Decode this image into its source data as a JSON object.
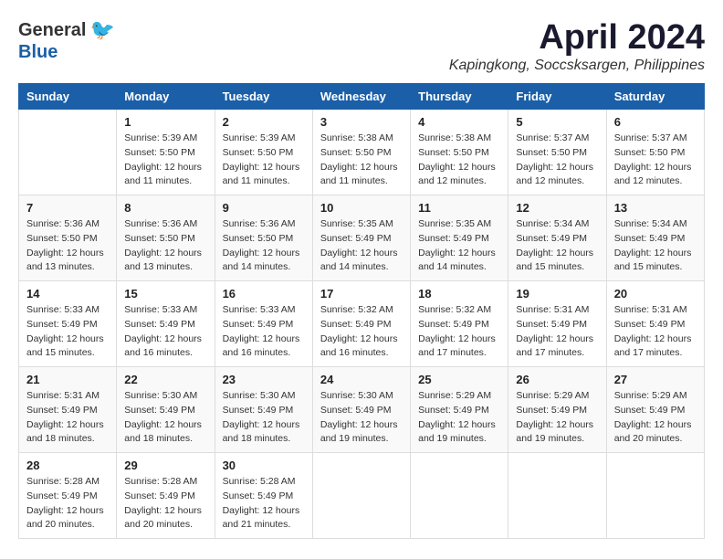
{
  "logo": {
    "general": "General",
    "blue": "Blue"
  },
  "title": "April 2024",
  "location": "Kapingkong, Soccsksargen, Philippines",
  "weekdays": [
    "Sunday",
    "Monday",
    "Tuesday",
    "Wednesday",
    "Thursday",
    "Friday",
    "Saturday"
  ],
  "weeks": [
    [
      {
        "day": "",
        "info": ""
      },
      {
        "day": "1",
        "info": "Sunrise: 5:39 AM\nSunset: 5:50 PM\nDaylight: 12 hours\nand 11 minutes."
      },
      {
        "day": "2",
        "info": "Sunrise: 5:39 AM\nSunset: 5:50 PM\nDaylight: 12 hours\nand 11 minutes."
      },
      {
        "day": "3",
        "info": "Sunrise: 5:38 AM\nSunset: 5:50 PM\nDaylight: 12 hours\nand 11 minutes."
      },
      {
        "day": "4",
        "info": "Sunrise: 5:38 AM\nSunset: 5:50 PM\nDaylight: 12 hours\nand 12 minutes."
      },
      {
        "day": "5",
        "info": "Sunrise: 5:37 AM\nSunset: 5:50 PM\nDaylight: 12 hours\nand 12 minutes."
      },
      {
        "day": "6",
        "info": "Sunrise: 5:37 AM\nSunset: 5:50 PM\nDaylight: 12 hours\nand 12 minutes."
      }
    ],
    [
      {
        "day": "7",
        "info": "Sunrise: 5:36 AM\nSunset: 5:50 PM\nDaylight: 12 hours\nand 13 minutes."
      },
      {
        "day": "8",
        "info": "Sunrise: 5:36 AM\nSunset: 5:50 PM\nDaylight: 12 hours\nand 13 minutes."
      },
      {
        "day": "9",
        "info": "Sunrise: 5:36 AM\nSunset: 5:50 PM\nDaylight: 12 hours\nand 14 minutes."
      },
      {
        "day": "10",
        "info": "Sunrise: 5:35 AM\nSunset: 5:49 PM\nDaylight: 12 hours\nand 14 minutes."
      },
      {
        "day": "11",
        "info": "Sunrise: 5:35 AM\nSunset: 5:49 PM\nDaylight: 12 hours\nand 14 minutes."
      },
      {
        "day": "12",
        "info": "Sunrise: 5:34 AM\nSunset: 5:49 PM\nDaylight: 12 hours\nand 15 minutes."
      },
      {
        "day": "13",
        "info": "Sunrise: 5:34 AM\nSunset: 5:49 PM\nDaylight: 12 hours\nand 15 minutes."
      }
    ],
    [
      {
        "day": "14",
        "info": "Sunrise: 5:33 AM\nSunset: 5:49 PM\nDaylight: 12 hours\nand 15 minutes."
      },
      {
        "day": "15",
        "info": "Sunrise: 5:33 AM\nSunset: 5:49 PM\nDaylight: 12 hours\nand 16 minutes."
      },
      {
        "day": "16",
        "info": "Sunrise: 5:33 AM\nSunset: 5:49 PM\nDaylight: 12 hours\nand 16 minutes."
      },
      {
        "day": "17",
        "info": "Sunrise: 5:32 AM\nSunset: 5:49 PM\nDaylight: 12 hours\nand 16 minutes."
      },
      {
        "day": "18",
        "info": "Sunrise: 5:32 AM\nSunset: 5:49 PM\nDaylight: 12 hours\nand 17 minutes."
      },
      {
        "day": "19",
        "info": "Sunrise: 5:31 AM\nSunset: 5:49 PM\nDaylight: 12 hours\nand 17 minutes."
      },
      {
        "day": "20",
        "info": "Sunrise: 5:31 AM\nSunset: 5:49 PM\nDaylight: 12 hours\nand 17 minutes."
      }
    ],
    [
      {
        "day": "21",
        "info": "Sunrise: 5:31 AM\nSunset: 5:49 PM\nDaylight: 12 hours\nand 18 minutes."
      },
      {
        "day": "22",
        "info": "Sunrise: 5:30 AM\nSunset: 5:49 PM\nDaylight: 12 hours\nand 18 minutes."
      },
      {
        "day": "23",
        "info": "Sunrise: 5:30 AM\nSunset: 5:49 PM\nDaylight: 12 hours\nand 18 minutes."
      },
      {
        "day": "24",
        "info": "Sunrise: 5:30 AM\nSunset: 5:49 PM\nDaylight: 12 hours\nand 19 minutes."
      },
      {
        "day": "25",
        "info": "Sunrise: 5:29 AM\nSunset: 5:49 PM\nDaylight: 12 hours\nand 19 minutes."
      },
      {
        "day": "26",
        "info": "Sunrise: 5:29 AM\nSunset: 5:49 PM\nDaylight: 12 hours\nand 19 minutes."
      },
      {
        "day": "27",
        "info": "Sunrise: 5:29 AM\nSunset: 5:49 PM\nDaylight: 12 hours\nand 20 minutes."
      }
    ],
    [
      {
        "day": "28",
        "info": "Sunrise: 5:28 AM\nSunset: 5:49 PM\nDaylight: 12 hours\nand 20 minutes."
      },
      {
        "day": "29",
        "info": "Sunrise: 5:28 AM\nSunset: 5:49 PM\nDaylight: 12 hours\nand 20 minutes."
      },
      {
        "day": "30",
        "info": "Sunrise: 5:28 AM\nSunset: 5:49 PM\nDaylight: 12 hours\nand 21 minutes."
      },
      {
        "day": "",
        "info": ""
      },
      {
        "day": "",
        "info": ""
      },
      {
        "day": "",
        "info": ""
      },
      {
        "day": "",
        "info": ""
      }
    ]
  ]
}
